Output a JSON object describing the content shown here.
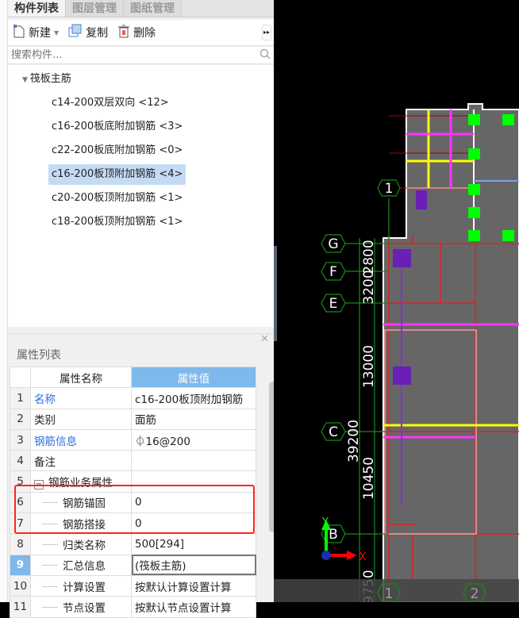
{
  "tabs": [
    "构件列表",
    "图层管理",
    "图纸管理"
  ],
  "toolbar": {
    "new": "新建",
    "copy": "复制",
    "delete": "删除"
  },
  "search": {
    "placeholder": "搜索构件..."
  },
  "tree": {
    "root": "筏板主筋",
    "items": [
      "c14-200双层双向 <12>",
      "c16-200板底附加钢筋 <3>",
      "c22-200板底附加钢筋 <0>",
      "c16-200板顶附加钢筋 <4>",
      "c20-200板顶附加钢筋 <1>",
      "c18-200板顶附加钢筋 <1>"
    ],
    "selected_index": 3
  },
  "props": {
    "title": "属性列表",
    "headers": {
      "name": "属性名称",
      "value": "属性值"
    },
    "rows": [
      {
        "n": "1",
        "name": "名称",
        "value": "c16-200板顶附加钢筋"
      },
      {
        "n": "2",
        "name": "类别",
        "value": "面筋"
      },
      {
        "n": "3",
        "name": "钢筋信息",
        "value": "⏀16@200"
      },
      {
        "n": "4",
        "name": "备注",
        "value": ""
      },
      {
        "n": "5",
        "name": "钢筋业务属性",
        "value": ""
      },
      {
        "n": "6",
        "name": "钢筋锚固",
        "value": "0"
      },
      {
        "n": "7",
        "name": "钢筋搭接",
        "value": "0"
      },
      {
        "n": "8",
        "name": "归类名称",
        "value": "500[294]"
      },
      {
        "n": "9",
        "name": "汇总信息",
        "value": "(筏板主筋)"
      },
      {
        "n": "10",
        "name": "计算设置",
        "value": "按默认计算设置计算"
      },
      {
        "n": "11",
        "name": "节点设置",
        "value": "按默认节点设置计算"
      }
    ]
  },
  "canvas": {
    "axes": {
      "top": "1",
      "g": "G",
      "f": "F",
      "e": "E",
      "c": "C",
      "b": "B",
      "bottom1": "1",
      "bottom2": "2"
    },
    "dims": {
      "d1": "2800",
      "d2": "3200",
      "d3": "13000",
      "d4": "39200",
      "d5": "10450",
      "d6": "9750"
    },
    "ucs": {
      "x": "X",
      "y": "Y"
    }
  }
}
